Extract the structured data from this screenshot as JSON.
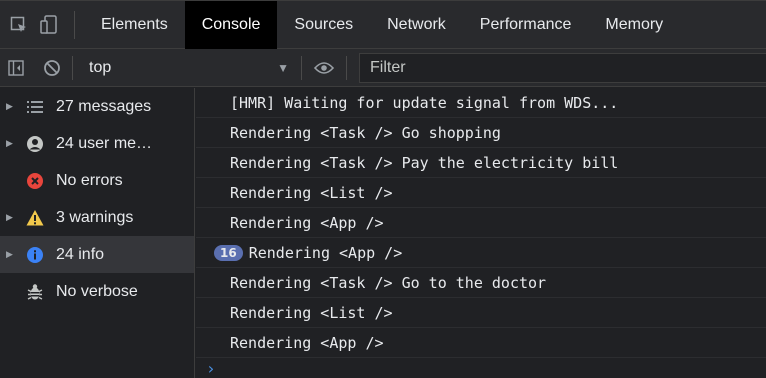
{
  "tabs": [
    {
      "label": "Elements"
    },
    {
      "label": "Console"
    },
    {
      "label": "Sources"
    },
    {
      "label": "Network"
    },
    {
      "label": "Performance"
    },
    {
      "label": "Memory"
    }
  ],
  "active_tab": "Console",
  "toolbar": {
    "context": "top",
    "filter_placeholder": "Filter"
  },
  "sidebar": {
    "items": [
      {
        "label": "27 messages",
        "icon": "list-icon"
      },
      {
        "label": "24 user me…",
        "icon": "user-icon"
      },
      {
        "label": "No errors",
        "icon": "error-icon"
      },
      {
        "label": "3 warnings",
        "icon": "warning-icon"
      },
      {
        "label": "24 info",
        "icon": "info-icon"
      },
      {
        "label": "No verbose",
        "icon": "bug-icon"
      }
    ],
    "selected": "24 info"
  },
  "console": {
    "messages": [
      {
        "text": "[HMR] Waiting for update signal from WDS..."
      },
      {
        "text": "Rendering <Task /> Go shopping"
      },
      {
        "text": "Rendering <Task /> Pay the electricity bill"
      },
      {
        "text": "Rendering <List />"
      },
      {
        "text": "Rendering <App />"
      },
      {
        "text": "Rendering <App />",
        "repeat": "16"
      },
      {
        "text": "Rendering <Task /> Go to the doctor"
      },
      {
        "text": "Rendering <List />"
      },
      {
        "text": "Rendering <App />"
      }
    ],
    "prompt": "›"
  },
  "colors": {
    "background": "#202124",
    "toolbar": "#292a2d",
    "active_tab": "#000000",
    "error": "#e8453c",
    "warning": "#f2c94c",
    "info": "#3b82f6",
    "badge": "#5a6fb0"
  }
}
